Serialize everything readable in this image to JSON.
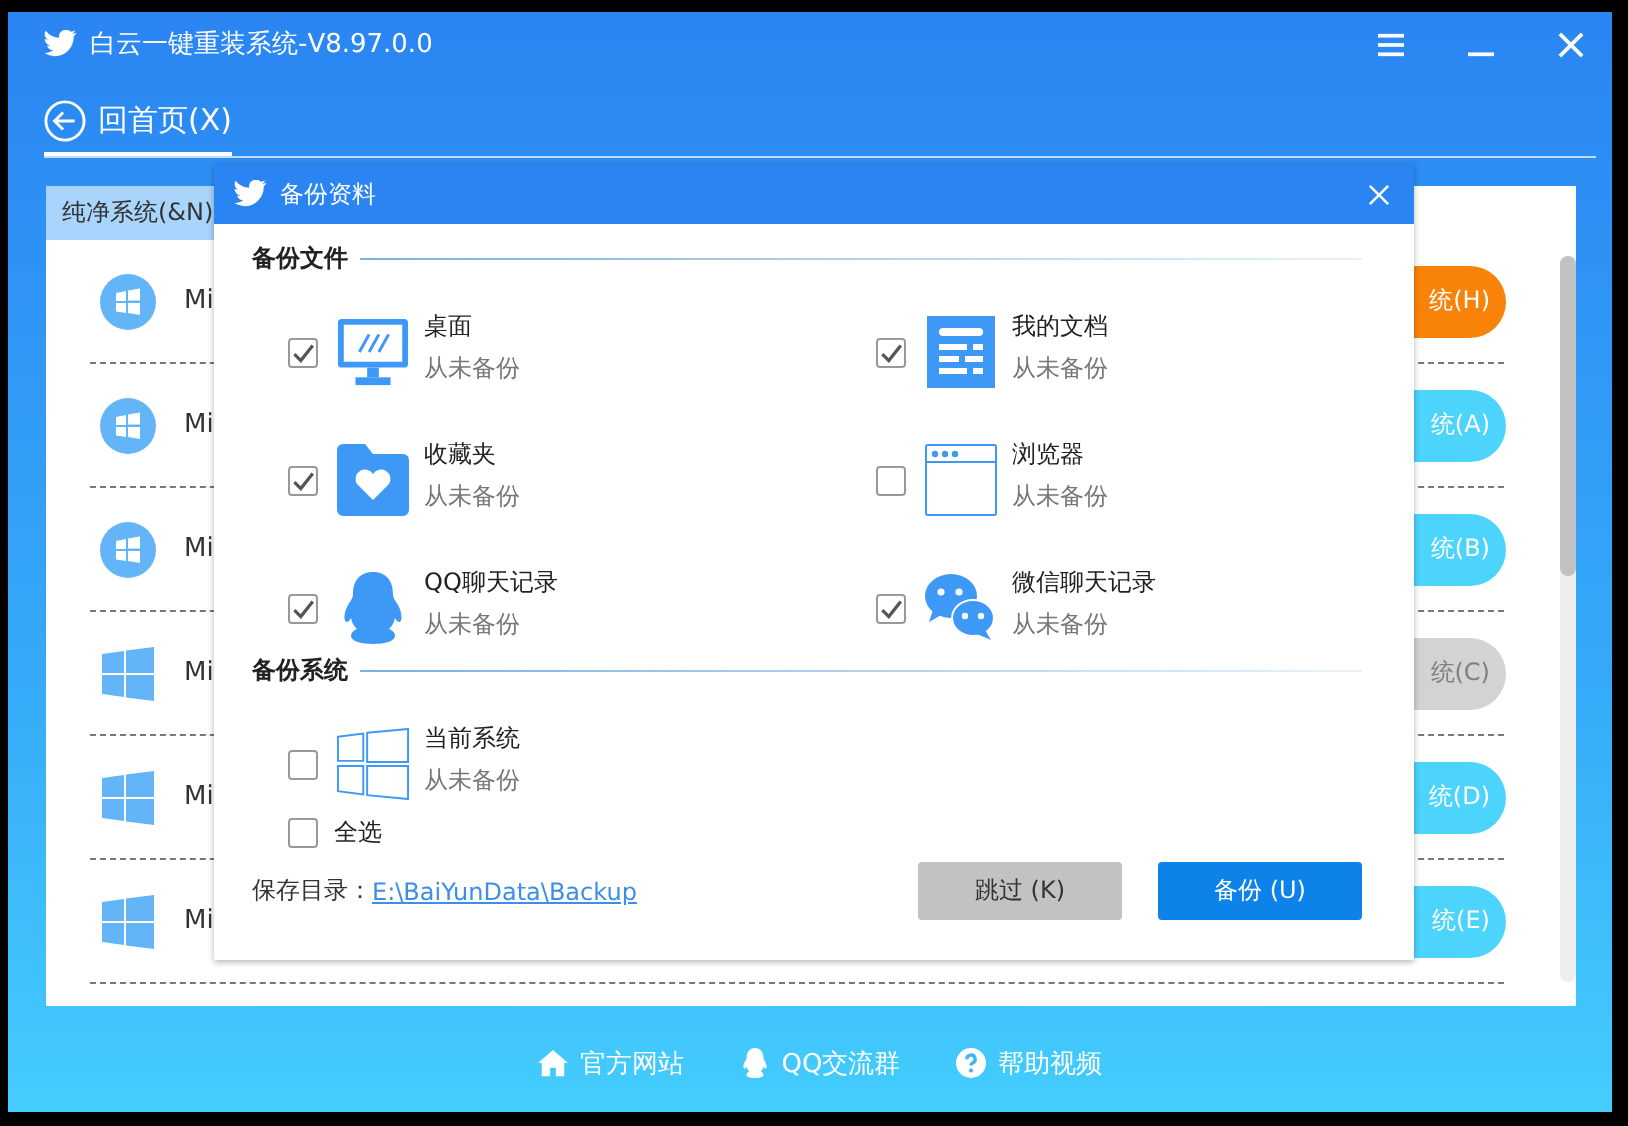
{
  "window": {
    "title": "白云一键重装系统-V8.97.0.0"
  },
  "nav": {
    "back": "回首页(X)"
  },
  "tabs": [
    {
      "label": "纯净系统(&N)",
      "selected": true
    }
  ],
  "systems": [
    {
      "kind": "round",
      "name": "Mi",
      "button": "统(H)",
      "highlighted": true,
      "disabled": false
    },
    {
      "kind": "round",
      "name": "Mi",
      "button": "统(A)",
      "highlighted": false,
      "disabled": false
    },
    {
      "kind": "round",
      "name": "Mi",
      "button": "统(B)",
      "highlighted": false,
      "disabled": false
    },
    {
      "kind": "flat",
      "name": "Mi",
      "button": "统(C)",
      "highlighted": false,
      "disabled": true
    },
    {
      "kind": "flat",
      "name": "Mi",
      "button": "统(D)",
      "highlighted": false,
      "disabled": false
    },
    {
      "kind": "flat",
      "name": "Mi",
      "button": "统(E)",
      "highlighted": false,
      "disabled": false
    }
  ],
  "dialog": {
    "title": "备份资料",
    "sections": [
      {
        "title": "备份文件",
        "items": [
          {
            "kind": "monitor",
            "label": "桌面",
            "status": "从未备份",
            "checked": true
          },
          {
            "kind": "document",
            "label": "我的文档",
            "status": "从未备份",
            "checked": true
          },
          {
            "kind": "folder",
            "label": "收藏夹",
            "status": "从未备份",
            "checked": true
          },
          {
            "kind": "browser",
            "label": "浏览器",
            "status": "从未备份",
            "checked": false
          },
          {
            "kind": "qq",
            "label": "QQ聊天记录",
            "status": "从未备份",
            "checked": true
          },
          {
            "kind": "wechat",
            "label": "微信聊天记录",
            "status": "从未备份",
            "checked": true
          }
        ]
      },
      {
        "title": "备份系统",
        "items": [
          {
            "kind": "windows",
            "label": "当前系统",
            "status": "从未备份",
            "checked": false
          }
        ]
      }
    ],
    "select_all": {
      "label": "全选",
      "checked": false
    },
    "save_dir": {
      "label": "保存目录：",
      "path": "E:\\BaiYunData\\Backup"
    },
    "buttons": [
      {
        "label": "跳过 (K)",
        "kind": "secondary"
      },
      {
        "label": "备份 (U)",
        "kind": "primary"
      }
    ]
  },
  "footer": [
    {
      "kind": "home",
      "label": "官方网站"
    },
    {
      "kind": "qq",
      "label": "QQ交流群"
    },
    {
      "kind": "help",
      "label": "帮助视频"
    }
  ]
}
